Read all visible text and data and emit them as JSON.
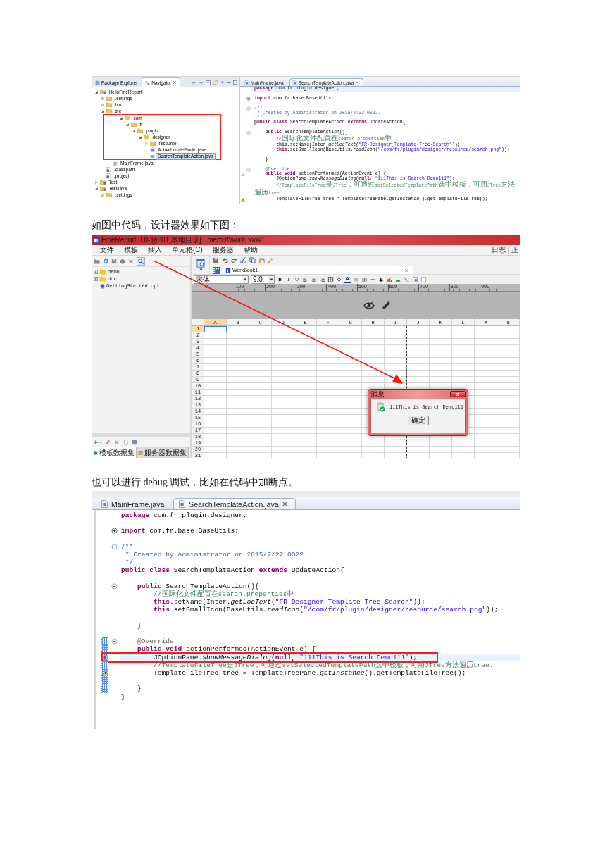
{
  "figure_1": {
    "views": [
      {
        "label": "Package Explorer",
        "selected": false
      },
      {
        "label": "Navigator",
        "selected": true
      }
    ],
    "tree": [
      {
        "label": "HelloFineReport",
        "kind": "project",
        "expanded": true,
        "selected": false,
        "children": [
          {
            "label": ".settings",
            "kind": "folder",
            "expanded": false,
            "selected": false
          },
          {
            "label": "bin",
            "kind": "folder",
            "expanded": false,
            "selected": false
          },
          {
            "label": "src",
            "kind": "folder",
            "expanded": true,
            "selected": false,
            "children": [
              {
                "label": "com",
                "kind": "folder",
                "expanded": true,
                "selected": false,
                "annotated": true,
                "children": [
                  {
                    "label": "fr",
                    "kind": "folder",
                    "expanded": true,
                    "selected": false,
                    "children": [
                      {
                        "label": "plugin",
                        "kind": "folder",
                        "expanded": true,
                        "selected": false,
                        "children": [
                          {
                            "label": "designer",
                            "kind": "folder",
                            "expanded": true,
                            "selected": false,
                            "children": [
                              {
                                "label": "resource",
                                "kind": "folder",
                                "expanded": false,
                                "selected": false
                              },
                              {
                                "label": "ActualLocaleFinder.java",
                                "kind": "java",
                                "selected": false
                              },
                              {
                                "label": "SearchTemplateAction.java",
                                "kind": "java",
                                "selected": true
                              }
                            ]
                          }
                        ]
                      }
                    ]
                  }
                ]
              },
              {
                "label": "MainFrame.java",
                "kind": "java",
                "selected": false
              }
            ]
          },
          {
            "label": ".classpath",
            "kind": "config",
            "selected": false
          },
          {
            "label": ".project",
            "kind": "config",
            "selected": false
          }
        ]
      },
      {
        "label": "Test",
        "kind": "project",
        "expanded": false,
        "selected": false
      },
      {
        "label": "TestJava",
        "kind": "project",
        "expanded": true,
        "selected": false,
        "children": [
          {
            "label": ".settings",
            "kind": "folder",
            "expanded": false,
            "selected": false
          }
        ]
      }
    ],
    "editor": {
      "tabs": [
        {
          "label": "MainFrame.java",
          "selected": false
        },
        {
          "label": "SearchTemplateAction.java",
          "selected": true
        }
      ],
      "lines": [
        {
          "kind": "code",
          "current": true,
          "segments": [
            {
              "kind": "kw",
              "text": "package"
            },
            {
              "kind": "plain",
              "text": " com.fr.plugin.designer;"
            }
          ]
        },
        {
          "kind": "blank"
        },
        {
          "kind": "code",
          "folded": true,
          "segments": [
            {
              "kind": "kw",
              "text": "import"
            },
            {
              "kind": "plain",
              "text": " com.fr.base.BaseUtils;"
            }
          ]
        },
        {
          "kind": "blank"
        },
        {
          "kind": "code",
          "folded": false,
          "segments": [
            {
              "kind": "doc",
              "text": "/**"
            }
          ]
        },
        {
          "kind": "code",
          "segments": [
            {
              "kind": "doc",
              "text": " * Created by Administrator on 2015/7/22 0022."
            }
          ]
        },
        {
          "kind": "code",
          "segments": [
            {
              "kind": "doc",
              "text": " */"
            }
          ]
        },
        {
          "kind": "code",
          "segments": [
            {
              "kind": "kw",
              "text": "public"
            },
            {
              "kind": "kw",
              "text": " class"
            },
            {
              "kind": "plain",
              "text": " SearchTemplateAction "
            },
            {
              "kind": "kw",
              "text": "extends"
            },
            {
              "kind": "plain",
              "text": " UpdateAction{"
            }
          ]
        },
        {
          "kind": "blank"
        },
        {
          "kind": "code",
          "folded": false,
          "segments": [
            {
              "kind": "kw",
              "text": "    public"
            },
            {
              "kind": "plain",
              "text": " SearchTemplateAction(){"
            }
          ]
        },
        {
          "kind": "code",
          "segments": [
            {
              "kind": "comment",
              "text": "        //国际化文件配置在search.properties中"
            }
          ]
        },
        {
          "kind": "code",
          "segments": [
            {
              "kind": "kw",
              "text": "        this"
            },
            {
              "kind": "plain",
              "text": ".setName(Inter."
            },
            {
              "kind": "static",
              "text": "getLocText"
            },
            {
              "kind": "plain",
              "text": "("
            },
            {
              "kind": "str",
              "text": "\"FR-Designer_Template-Tree-Search\""
            },
            {
              "kind": "plain",
              "text": "));"
            }
          ]
        },
        {
          "kind": "code",
          "segments": [
            {
              "kind": "kw",
              "text": "        this"
            },
            {
              "kind": "plain",
              "text": ".setSmallIcon(BaseUtils."
            },
            {
              "kind": "static",
              "text": "readIcon"
            },
            {
              "kind": "plain",
              "text": "("
            },
            {
              "kind": "str",
              "text": "\"/com/fr/plugin/designer/resource/search.png\""
            },
            {
              "kind": "plain",
              "text": "));"
            }
          ]
        },
        {
          "kind": "blank"
        },
        {
          "kind": "code",
          "segments": [
            {
              "kind": "plain",
              "text": "    }"
            }
          ]
        },
        {
          "kind": "blank"
        },
        {
          "kind": "code",
          "folded": false,
          "segments": [
            {
              "kind": "ann",
              "text": "    @Override"
            }
          ]
        },
        {
          "kind": "code",
          "override": true,
          "segments": [
            {
              "kind": "kw",
              "text": "    public"
            },
            {
              "kind": "kw",
              "text": " void"
            },
            {
              "kind": "plain",
              "text": " actionPerformed(ActionEvent e) {"
            }
          ]
        },
        {
          "kind": "code",
          "segments": [
            {
              "kind": "plain",
              "text": "        JOptionPane."
            },
            {
              "kind": "static",
              "text": "showMessageDialog"
            },
            {
              "kind": "plain",
              "text": "("
            },
            {
              "kind": "kw",
              "text": "null"
            },
            {
              "kind": "plain",
              "text": ", "
            },
            {
              "kind": "str",
              "text": "\"111This is Search Demo111\""
            },
            {
              "kind": "plain",
              "text": ");"
            }
          ]
        },
        {
          "kind": "code",
          "segments": [
            {
              "kind": "comment",
              "text": "        //TemplateFileTree是JTree，可通过setSelectedTemplatePath选中模板，可用JTree方法遍历tree."
            }
          ]
        },
        {
          "kind": "code",
          "warning": true,
          "segments": [
            {
              "kind": "plain",
              "text": "        TemplateFileTree tree = TemplateTreePane."
            },
            {
              "kind": "static",
              "text": "getInstance"
            },
            {
              "kind": "plain",
              "text": "().getTemplateFileTree();"
            }
          ]
        }
      ]
    }
  },
  "caption_1": "如图中代码，设计器效果如下图：",
  "figure_2": {
    "title": "FineReport 8.0-@801[本地目录]   mem://WorkBook1",
    "menus": [
      "文件",
      "模板",
      "插入",
      "单元格(C)",
      "服务器",
      "帮助"
    ],
    "menu_right": "日志 | 正",
    "tree": [
      {
        "label": "demo",
        "kind": "folder",
        "expanded": false,
        "selected": false
      },
      {
        "label": "doc",
        "kind": "folder",
        "expanded": false,
        "selected": false
      },
      {
        "label": "GettingStarted.cpt",
        "kind": "report",
        "selected": false
      }
    ],
    "dataset_tabs": [
      {
        "label": "模板数据集",
        "selected": true
      },
      {
        "label": "服务器数据集",
        "selected": false
      }
    ],
    "sheet_tabs": [
      {
        "label": "WorkBook1",
        "selected": true
      }
    ],
    "font": "宋体",
    "font_size": "9.0",
    "style_buttons": [
      "B",
      "I",
      "U"
    ],
    "font_color_button": "A",
    "ruler": [
      "0",
      "100",
      "200",
      "300",
      "400",
      "500",
      "600",
      "700",
      "800",
      "900"
    ],
    "columns": [
      {
        "label": "A",
        "selected": true,
        "page_break": false
      },
      {
        "label": "B",
        "selected": false,
        "page_break": false
      },
      {
        "label": "C",
        "selected": false,
        "page_break": false
      },
      {
        "label": "D",
        "selected": false,
        "page_break": false
      },
      {
        "label": "E",
        "selected": false,
        "page_break": false
      },
      {
        "label": "F",
        "selected": false,
        "page_break": false
      },
      {
        "label": "G",
        "selected": false,
        "page_break": false
      },
      {
        "label": "H",
        "selected": false,
        "page_break": false
      },
      {
        "label": "I",
        "selected": false,
        "page_break": true
      },
      {
        "label": "J",
        "selected": false,
        "page_break": false
      },
      {
        "label": "K",
        "selected": false,
        "page_break": false
      },
      {
        "label": "L",
        "selected": false,
        "page_break": false
      },
      {
        "label": "M",
        "selected": false,
        "page_break": false
      },
      {
        "label": "N",
        "selected": false,
        "page_break": false
      }
    ],
    "rows": [
      {
        "label": "1",
        "selected": true
      },
      {
        "label": "2",
        "selected": false
      },
      {
        "label": "3",
        "selected": false
      },
      {
        "label": "4",
        "selected": false
      },
      {
        "label": "5",
        "selected": false
      },
      {
        "label": "6",
        "selected": false
      },
      {
        "label": "7",
        "selected": false
      },
      {
        "label": "8",
        "selected": false
      },
      {
        "label": "9",
        "selected": false
      },
      {
        "label": "10",
        "selected": false
      },
      {
        "label": "11",
        "selected": false
      },
      {
        "label": "12",
        "selected": false
      },
      {
        "label": "13",
        "selected": false
      },
      {
        "label": "14",
        "selected": false
      },
      {
        "label": "15",
        "selected": false
      },
      {
        "label": "16",
        "selected": false
      },
      {
        "label": "17",
        "selected": false
      },
      {
        "label": "18",
        "selected": false
      },
      {
        "label": "19",
        "selected": false
      },
      {
        "label": "20",
        "selected": false
      },
      {
        "label": "21",
        "selected": false
      }
    ],
    "dialog": {
      "title": "消息",
      "message": "111This is Search Demo111",
      "button": "确定"
    }
  },
  "caption_2": "也可以进行 debug 调试，比如在代码中加断点。",
  "figure_3": {
    "editor": {
      "tabs": [
        {
          "label": "MainFrame.java",
          "selected": false
        },
        {
          "label": "SearchTemplateAction.java",
          "selected": true
        }
      ],
      "lines": [
        {
          "kind": "code",
          "segments": [
            {
              "kind": "kw",
              "text": "package"
            },
            {
              "kind": "plain",
              "text": " com.fr.plugin.designer;"
            }
          ]
        },
        {
          "kind": "blank"
        },
        {
          "kind": "code",
          "folded": true,
          "segments": [
            {
              "kind": "kw",
              "text": "import"
            },
            {
              "kind": "plain",
              "text": " com.fr.base.BaseUtils;"
            }
          ]
        },
        {
          "kind": "blank"
        },
        {
          "kind": "code",
          "folded": false,
          "segments": [
            {
              "kind": "doc",
              "text": "/**"
            }
          ]
        },
        {
          "kind": "code",
          "segments": [
            {
              "kind": "doc",
              "text": " * Created by Administrator on 2015/7/22 0022."
            }
          ]
        },
        {
          "kind": "code",
          "segments": [
            {
              "kind": "doc",
              "text": " */"
            }
          ]
        },
        {
          "kind": "code",
          "segments": [
            {
              "kind": "kw",
              "text": "public"
            },
            {
              "kind": "kw",
              "text": " class"
            },
            {
              "kind": "plain",
              "text": " SearchTemplateAction "
            },
            {
              "kind": "kw",
              "text": "extends"
            },
            {
              "kind": "plain",
              "text": " UpdateAction{"
            }
          ]
        },
        {
          "kind": "blank"
        },
        {
          "kind": "code",
          "folded": false,
          "segments": [
            {
              "kind": "kw",
              "text": "    public"
            },
            {
              "kind": "plain",
              "text": " SearchTemplateAction(){"
            }
          ]
        },
        {
          "kind": "code",
          "segments": [
            {
              "kind": "comment",
              "text": "        //国际化文件配置在search.properties中"
            }
          ]
        },
        {
          "kind": "code",
          "segments": [
            {
              "kind": "kw",
              "text": "        this"
            },
            {
              "kind": "plain",
              "text": ".setName(Inter."
            },
            {
              "kind": "static",
              "text": "getLocText"
            },
            {
              "kind": "plain",
              "text": "("
            },
            {
              "kind": "str",
              "text": "\"FR-Designer_Template-Tree-Search\""
            },
            {
              "kind": "plain",
              "text": "));"
            }
          ]
        },
        {
          "kind": "code",
          "segments": [
            {
              "kind": "kw",
              "text": "        this"
            },
            {
              "kind": "plain",
              "text": ".setSmallIcon(BaseUtils."
            },
            {
              "kind": "static",
              "text": "readIcon"
            },
            {
              "kind": "plain",
              "text": "("
            },
            {
              "kind": "str",
              "text": "\"/com/fr/plugin/designer/resource/search.png\""
            },
            {
              "kind": "plain",
              "text": "));"
            }
          ]
        },
        {
          "kind": "blank"
        },
        {
          "kind": "code",
          "segments": [
            {
              "kind": "plain",
              "text": "    }"
            }
          ]
        },
        {
          "kind": "blank"
        },
        {
          "kind": "code",
          "folded": false,
          "debug_range": true,
          "segments": [
            {
              "kind": "ann",
              "text": "    @Override"
            }
          ]
        },
        {
          "kind": "code",
          "debug_range": true,
          "segments": [
            {
              "kind": "kw",
              "text": "    public"
            },
            {
              "kind": "kw",
              "text": " void"
            },
            {
              "kind": "plain",
              "text": " actionPerformed(ActionEvent e) {"
            }
          ]
        },
        {
          "kind": "code",
          "breakpoint": true,
          "current": true,
          "highlight": true,
          "segments": [
            {
              "kind": "plain",
              "text": "        JOptionPane."
            },
            {
              "kind": "static",
              "text": "showMessageDialog"
            },
            {
              "kind": "plain",
              "text": "("
            },
            {
              "kind": "kw",
              "text": "null"
            },
            {
              "kind": "plain",
              "text": ", "
            },
            {
              "kind": "str",
              "text": "\"111This is Search Demo111\""
            },
            {
              "kind": "plain",
              "text": ");"
            }
          ]
        },
        {
          "kind": "code",
          "debug_range": true,
          "segments": [
            {
              "kind": "comment",
              "text": "        //TemplateFileTree是JTree，可通过setSelectedTemplatePath选中模板，可用JTree方法遍历tree."
            }
          ]
        },
        {
          "kind": "code",
          "warning": true,
          "segments": [
            {
              "kind": "plain",
              "text": "        TemplateFileTree tree = TemplateTreePane."
            },
            {
              "kind": "static",
              "text": "getInstance"
            },
            {
              "kind": "plain",
              "text": "().getTemplateFileTree();"
            }
          ]
        },
        {
          "kind": "blank",
          "debug_range": true
        },
        {
          "kind": "code",
          "debug_range": true,
          "segments": [
            {
              "kind": "plain",
              "text": "    }"
            }
          ]
        },
        {
          "kind": "code",
          "segments": [
            {
              "kind": "plain",
              "text": "}"
            }
          ]
        }
      ]
    }
  }
}
